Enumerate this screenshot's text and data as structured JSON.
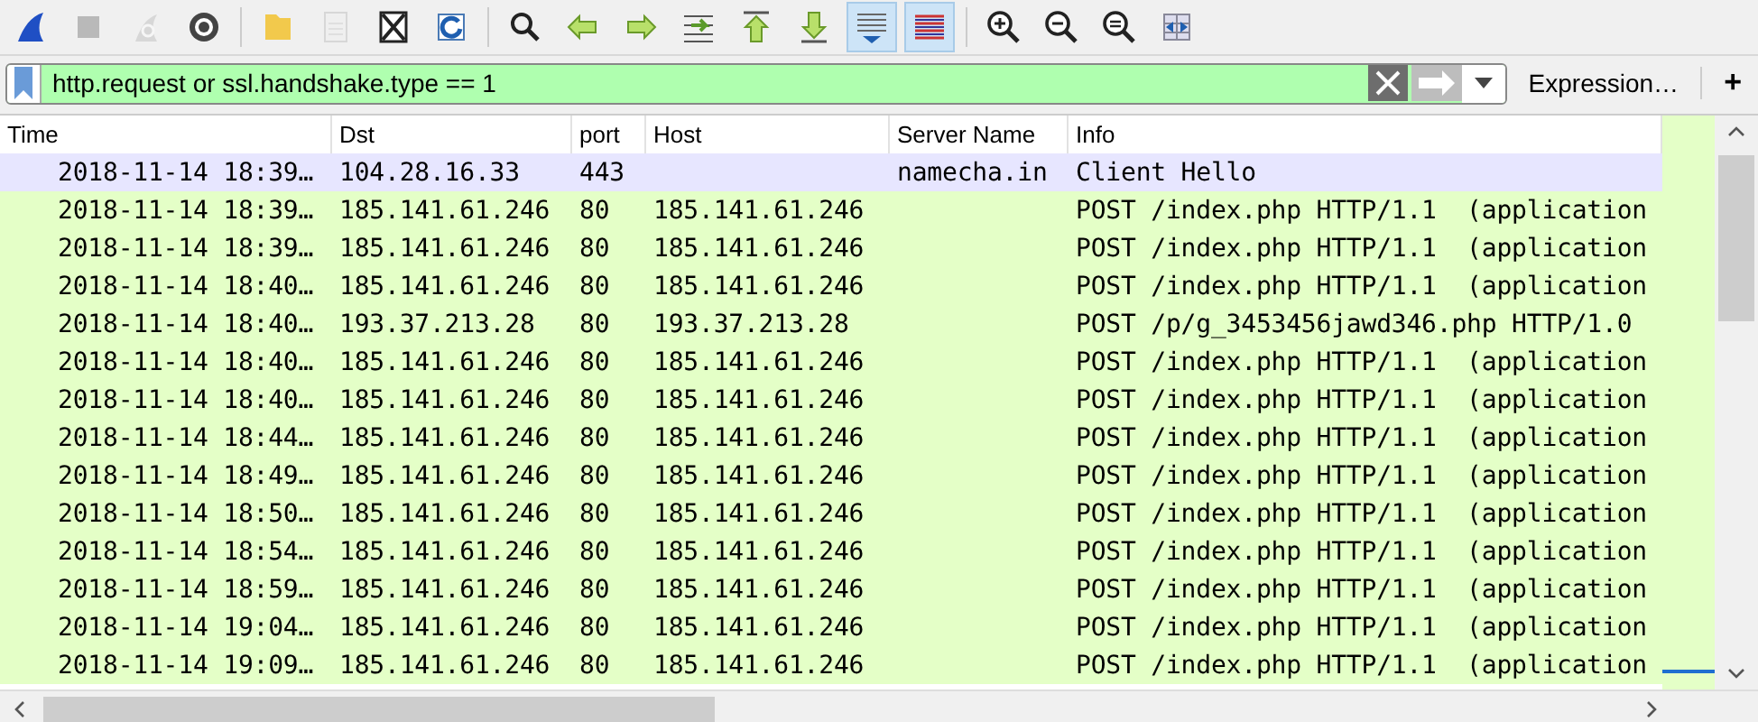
{
  "toolbar": [
    {
      "kind": "start",
      "on": false,
      "disabled": false
    },
    {
      "kind": "stop",
      "on": false,
      "disabled": true
    },
    {
      "kind": "restart",
      "on": false,
      "disabled": true
    },
    {
      "kind": "options",
      "on": false,
      "disabled": false
    },
    {
      "kind": "open",
      "on": false,
      "disabled": false
    },
    {
      "kind": "save",
      "on": false,
      "disabled": true
    },
    {
      "kind": "close",
      "on": false,
      "disabled": false
    },
    {
      "kind": "reload",
      "on": false,
      "disabled": false
    },
    {
      "kind": "find",
      "on": false,
      "disabled": false
    },
    {
      "kind": "back",
      "on": false,
      "disabled": false
    },
    {
      "kind": "forward",
      "on": false,
      "disabled": false
    },
    {
      "kind": "goto",
      "on": false,
      "disabled": false
    },
    {
      "kind": "first",
      "on": false,
      "disabled": false
    },
    {
      "kind": "last",
      "on": false,
      "disabled": false
    },
    {
      "kind": "autoscroll",
      "on": true,
      "disabled": false
    },
    {
      "kind": "colorize",
      "on": true,
      "disabled": false
    },
    {
      "kind": "zoomin",
      "on": false,
      "disabled": false
    },
    {
      "kind": "zoomout",
      "on": false,
      "disabled": false
    },
    {
      "kind": "zoomreset",
      "on": false,
      "disabled": false
    },
    {
      "kind": "resize",
      "on": false,
      "disabled": false
    }
  ],
  "filter": {
    "value": "http.request or ssl.handshake.type == 1",
    "expression_button": "Expression…",
    "add_button": "+"
  },
  "packet_list": {
    "columns": [
      "Time",
      "Dst",
      "port",
      "Host",
      "Server Name",
      "Info"
    ],
    "rows": [
      {
        "color": "#e7e6ff",
        "time": "2018-11-14 18:39…",
        "dst": "104.28.16.33",
        "port": "443",
        "server_name": "namecha.in",
        "info": "Client Hello"
      },
      {
        "color": "#e4ffc7",
        "time": "2018-11-14 18:39…",
        "dst": "185.141.61.246",
        "port": "80",
        "host": "185.141.61.246",
        "info": "POST /index.php HTTP/1.1  (application"
      },
      {
        "color": "#e4ffc7",
        "time": "2018-11-14 18:39…",
        "dst": "185.141.61.246",
        "port": "80",
        "host": "185.141.61.246",
        "info": "POST /index.php HTTP/1.1  (application"
      },
      {
        "color": "#e4ffc7",
        "time": "2018-11-14 18:40…",
        "dst": "185.141.61.246",
        "port": "80",
        "host": "185.141.61.246",
        "info": "POST /index.php HTTP/1.1  (application"
      },
      {
        "color": "#e4ffc7",
        "time": "2018-11-14 18:40…",
        "dst": "193.37.213.28",
        "port": "80",
        "host": "193.37.213.28",
        "info": "POST /p/g_3453456jawd346.php HTTP/1.0"
      },
      {
        "color": "#e4ffc7",
        "time": "2018-11-14 18:40…",
        "dst": "185.141.61.246",
        "port": "80",
        "host": "185.141.61.246",
        "info": "POST /index.php HTTP/1.1  (application"
      },
      {
        "color": "#e4ffc7",
        "time": "2018-11-14 18:40…",
        "dst": "185.141.61.246",
        "port": "80",
        "host": "185.141.61.246",
        "info": "POST /index.php HTTP/1.1  (application"
      },
      {
        "color": "#e4ffc7",
        "time": "2018-11-14 18:44…",
        "dst": "185.141.61.246",
        "port": "80",
        "host": "185.141.61.246",
        "info": "POST /index.php HTTP/1.1  (application"
      },
      {
        "color": "#e4ffc7",
        "time": "2018-11-14 18:49…",
        "dst": "185.141.61.246",
        "port": "80",
        "host": "185.141.61.246",
        "info": "POST /index.php HTTP/1.1  (application"
      },
      {
        "color": "#e4ffc7",
        "time": "2018-11-14 18:50…",
        "dst": "185.141.61.246",
        "port": "80",
        "host": "185.141.61.246",
        "info": "POST /index.php HTTP/1.1  (application"
      },
      {
        "color": "#e4ffc7",
        "time": "2018-11-14 18:54…",
        "dst": "185.141.61.246",
        "port": "80",
        "host": "185.141.61.246",
        "info": "POST /index.php HTTP/1.1  (application"
      },
      {
        "color": "#e4ffc7",
        "time": "2018-11-14 18:59…",
        "dst": "185.141.61.246",
        "port": "80",
        "host": "185.141.61.246",
        "info": "POST /index.php HTTP/1.1  (application"
      },
      {
        "color": "#e4ffc7",
        "time": "2018-11-14 19:04…",
        "dst": "185.141.61.246",
        "port": "80",
        "host": "185.141.61.246",
        "info": "POST /index.php HTTP/1.1  (application"
      },
      {
        "color": "#e4ffc7",
        "time": "2018-11-14 19:09…",
        "dst": "185.141.61.246",
        "port": "80",
        "host": "185.141.61.246",
        "info": "POST /index.php HTTP/1.1  (application"
      }
    ]
  }
}
